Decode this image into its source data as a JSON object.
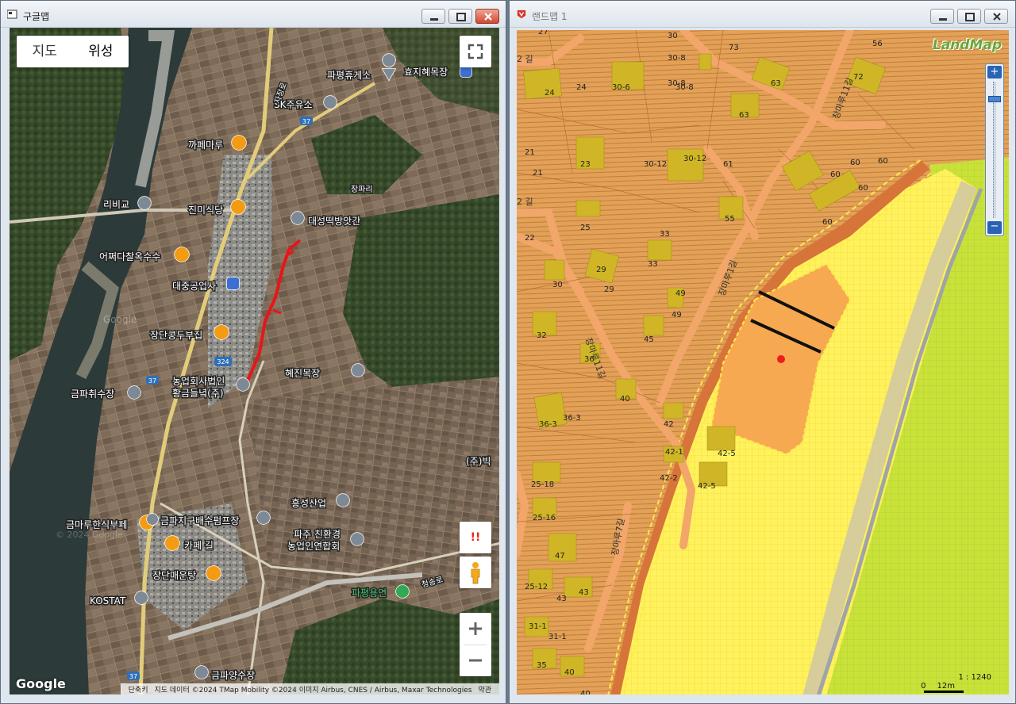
{
  "left_window": {
    "title": "구글맵",
    "map_type": {
      "map_label": "지도",
      "satellite_label": "위성"
    },
    "labels": {
      "pyeongpyeong_rest": "파평휴게소",
      "hyoji_ranch": "효지혜목장",
      "sk_gas": "SK주유소",
      "road_37_a": "37",
      "jajang_ro": "자장로",
      "cafe_maru": "까페마루",
      "ribigyo": "리비교",
      "jinmi_restaurant": "진미식당",
      "jangpari": "장파리",
      "daesung_mill": "대성떡방앗간",
      "corn_shop": "어쩌다찰옥수수",
      "daejung_industry": "대중공업사",
      "jangdan_tofu": "장단콩두부집",
      "road_324": "324",
      "road_37_b": "37",
      "farm_corp_1": "농업회사법인",
      "farm_corp_2": "황금들녘(주)",
      "hyejin_ranch": "혜진목장",
      "geumpa_intake": "금파취수장",
      "bikeu": "(주)빅",
      "heungsung_industry": "흥성산업",
      "geummaru_buffet": "금마루한식부페",
      "geumpa_pump": "금파지구배수펌프장",
      "paju_eco_1": "파주 친환경",
      "paju_eco_2": "농업인연합회",
      "cafe_gil": "카페 길",
      "jangdan_maeuntang": "장단매운탕",
      "kostat": "KOSTAT",
      "pyeongpyeong_yongyeon": "파평용연",
      "cheongsong_ro": "청송로",
      "geumpa_yangsu": "금파양수장",
      "road_37_c": "37",
      "google_watermark": "Google",
      "google_watermark_2": "© 2024 Google"
    },
    "google_logo": "Google",
    "attribution": {
      "shortcuts": "단축키",
      "data": "지도 데이터 ©2024 TMap Mobility ©2024 이미지 Airbus, CNES / Airbus, Maxar Technologies",
      "terms": "약관"
    },
    "alert_icon_text": "!!"
  },
  "right_window": {
    "title": "랜드맵 1",
    "logo": "LandMap",
    "scale_ratio": "1 : 1240",
    "scale_zero": "0",
    "scale_distance": "12m",
    "zoom_in": "+",
    "zoom_out": "−",
    "roads": {
      "r1": "2 길",
      "r2": "창마루11길",
      "r3": "장마루11길",
      "r4": "장마루1길",
      "r5": "장마루7길",
      "r6": "2 길"
    },
    "parcels": [
      "27",
      "30",
      "30-8",
      "30-8",
      "30-6",
      "30-8",
      "73",
      "56",
      "72",
      "24",
      "24",
      "63",
      "63",
      "21",
      "21",
      "23",
      "30-12",
      "30-12",
      "61",
      "60",
      "60",
      "60",
      "55",
      "60",
      "60",
      "25",
      "33",
      "22",
      "33",
      "29",
      "29",
      "30",
      "49",
      "49",
      "32",
      "45",
      "36",
      "40",
      "36-3",
      "36-3",
      "42",
      "42-1",
      "42-5",
      "42-2",
      "42-5",
      "25-18",
      "25-16",
      "47",
      "25-12",
      "43",
      "43",
      "31-1",
      "31-1",
      "35",
      "40",
      "40"
    ]
  },
  "colors": {
    "satellite_field": "#7b6a58",
    "river": "#2c3a3a",
    "red_route": "#e8151b",
    "landmap_bg": "#e3a157",
    "yellow_zone": "#fff15a",
    "green_zone": "#c9e23a",
    "orange_site": "#f7a952",
    "building": "#d0b626"
  }
}
